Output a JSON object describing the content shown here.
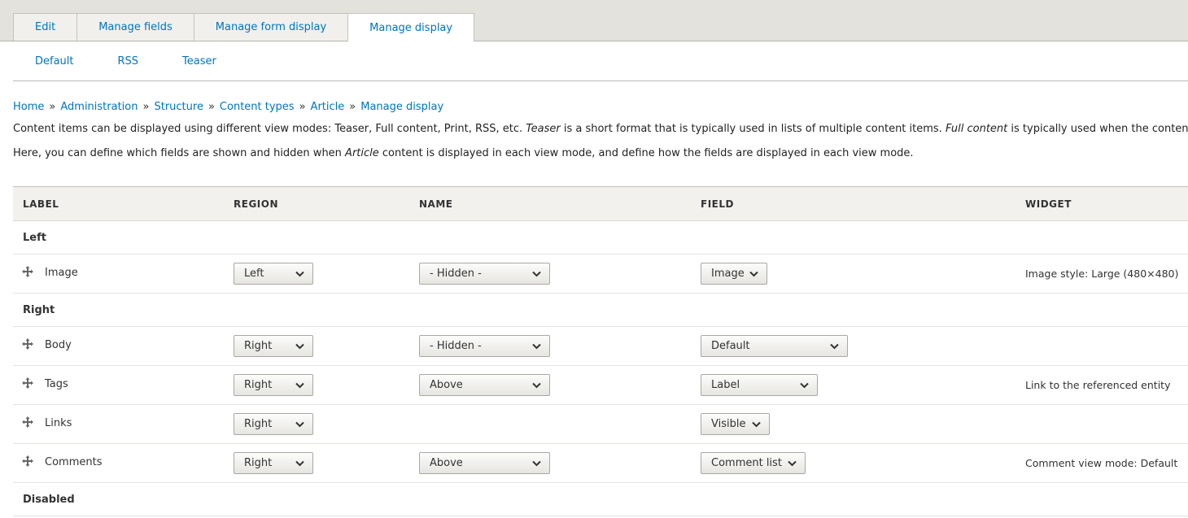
{
  "primary_tabs": [
    "Edit",
    "Manage fields",
    "Manage form display",
    "Manage display"
  ],
  "secondary_tabs": [
    "Default",
    "RSS",
    "Teaser"
  ],
  "breadcrumb": [
    "Home",
    "Administration",
    "Structure",
    "Content types",
    "Article",
    "Manage display"
  ],
  "breadcrumb_separator": "»",
  "description1": {
    "part1": "Content items can be displayed using different view modes: Teaser, Full content, Print, RSS, etc. ",
    "em1": "Teaser",
    "part2": " is a short format that is typically used in lists of multiple content items. ",
    "em2": "Full content",
    "part3": " is typically used when the content"
  },
  "description2": {
    "part1": "Here, you can define which fields are shown and hidden when ",
    "em1": "Article",
    "part2": " content is displayed in each view mode, and define how the fields are displayed in each view mode."
  },
  "table": {
    "headers": [
      "LABEL",
      "REGION",
      "NAME",
      "FIELD",
      "WIDGET"
    ],
    "regions": {
      "left": "Left",
      "right": "Right",
      "disabled": "Disabled"
    },
    "rows": [
      {
        "label": "Image",
        "region": "Left",
        "name": "- Hidden -",
        "field": "Image",
        "widget": "Image style: Large (480×480)"
      },
      {
        "label": "Body",
        "region": "Right",
        "name": "- Hidden -",
        "field": "Default",
        "widget": ""
      },
      {
        "label": "Tags",
        "region": "Right",
        "name": "Above",
        "field": "Label",
        "widget": "Link to the referenced entity"
      },
      {
        "label": "Links",
        "region": "Right",
        "name": "",
        "field": "Visible",
        "widget": ""
      },
      {
        "label": "Comments",
        "region": "Right",
        "name": "Above",
        "field": "Comment list",
        "widget": "Comment view mode: Default"
      }
    ]
  },
  "icons": {
    "drag": "drag-handle-icon",
    "chevron": "chevron-down-icon"
  }
}
